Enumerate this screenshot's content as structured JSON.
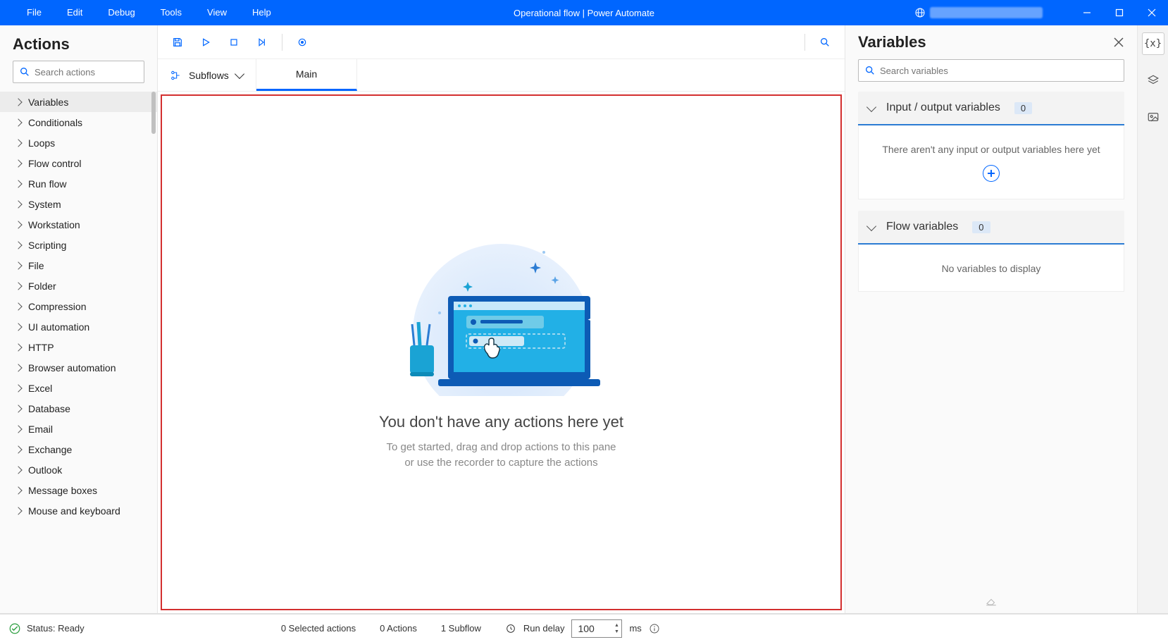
{
  "title": "Operational flow | Power Automate",
  "menu": [
    "File",
    "Edit",
    "Debug",
    "Tools",
    "View",
    "Help"
  ],
  "left": {
    "header": "Actions",
    "search_placeholder": "Search actions",
    "categories": [
      "Variables",
      "Conditionals",
      "Loops",
      "Flow control",
      "Run flow",
      "System",
      "Workstation",
      "Scripting",
      "File",
      "Folder",
      "Compression",
      "UI automation",
      "HTTP",
      "Browser automation",
      "Excel",
      "Database",
      "Email",
      "Exchange",
      "Outlook",
      "Message boxes",
      "Mouse and keyboard"
    ],
    "selected_index": 0
  },
  "center": {
    "subflows_label": "Subflows",
    "tab_main": "Main",
    "empty_title": "You don't have any actions here yet",
    "empty_sub1": "To get started, drag and drop actions to this pane",
    "empty_sub2": "or use the recorder to capture the actions"
  },
  "right": {
    "header": "Variables",
    "search_placeholder": "Search variables",
    "io_title": "Input / output variables",
    "io_count": "0",
    "io_empty": "There aren't any input or output variables here yet",
    "flow_title": "Flow variables",
    "flow_count": "0",
    "flow_empty": "No variables to display"
  },
  "status": {
    "ready": "Status: Ready",
    "selected": "0 Selected actions",
    "actions": "0 Actions",
    "subflows": "1 Subflow",
    "run_delay_label": "Run delay",
    "run_delay_value": "100",
    "ms": "ms"
  }
}
